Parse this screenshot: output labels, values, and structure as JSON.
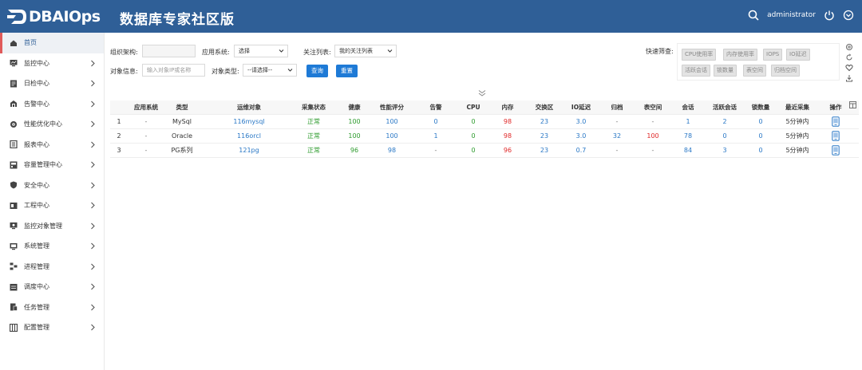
{
  "header": {
    "logo_text": "DBAIOps",
    "title": "数据库专家社区版",
    "username": "administrator"
  },
  "sidebar": {
    "items": [
      {
        "label": "首页",
        "icon": "home-icon",
        "active": true,
        "has_arrow": false
      },
      {
        "label": "监控中心",
        "icon": "monitor-icon",
        "has_arrow": true
      },
      {
        "label": "日检中心",
        "icon": "daily-check-icon",
        "has_arrow": true
      },
      {
        "label": "告警中心",
        "icon": "alarm-icon",
        "has_arrow": true
      },
      {
        "label": "性能优化中心",
        "icon": "performance-icon",
        "has_arrow": true
      },
      {
        "label": "报表中心",
        "icon": "report-icon",
        "has_arrow": true
      },
      {
        "label": "容量管理中心",
        "icon": "capacity-icon",
        "has_arrow": true
      },
      {
        "label": "安全中心",
        "icon": "shield-icon",
        "has_arrow": true
      },
      {
        "label": "工程中心",
        "icon": "project-icon",
        "has_arrow": true
      },
      {
        "label": "监控对象管理",
        "icon": "monitor-object-icon",
        "has_arrow": true
      },
      {
        "label": "系统管理",
        "icon": "system-icon",
        "has_arrow": true
      },
      {
        "label": "进程管理",
        "icon": "process-icon",
        "has_arrow": true
      },
      {
        "label": "调度中心",
        "icon": "schedule-icon",
        "has_arrow": true
      },
      {
        "label": "任务管理",
        "icon": "task-icon",
        "has_arrow": true
      },
      {
        "label": "配置管理",
        "icon": "config-icon",
        "has_arrow": true
      }
    ]
  },
  "filters": {
    "org_label": "组织架构:",
    "org_value": "",
    "app_system_label": "应用系统:",
    "app_system_value": "选择",
    "focus_list_label": "关注列表:",
    "focus_list_value": "我的关注列表",
    "object_info_label": "对象信息:",
    "object_info_placeholder": "输入对象IP或名称",
    "object_type_label": "对象类型:",
    "object_type_value": "--请选择--",
    "query_button": "查询",
    "reset_button": "重置"
  },
  "quick_filter": {
    "label": "快速筛查:",
    "tags": [
      "CPU使用率",
      "内存使用率",
      "IOPS",
      "IO延迟",
      "活跃会话",
      "锁数量",
      "表空间",
      "归档空间"
    ]
  },
  "table": {
    "headers": [
      "",
      "应用系统",
      "类型",
      "运维对象",
      "采集状态",
      "健康",
      "性能评分",
      "告警",
      "CPU",
      "内存",
      "交换区",
      "IO延迟",
      "归档",
      "表空间",
      "会话",
      "活跃会话",
      "锁数量",
      "最近采集",
      "操作"
    ],
    "rows": [
      {
        "no": "1",
        "app": "-",
        "type": "MySql",
        "obj": "116mysql",
        "state": "正常",
        "health": "100",
        "perf": "100",
        "alarm": "0",
        "cpu": "0",
        "mem": "98",
        "swap": "23",
        "io": "3.0",
        "arch": "-",
        "tbs": "-",
        "sess": "1",
        "asess": "2",
        "lock": "0",
        "last": "5分钟内"
      },
      {
        "no": "2",
        "app": "-",
        "type": "Oracle",
        "obj": "116orcl",
        "state": "正常",
        "health": "100",
        "perf": "100",
        "alarm": "1",
        "cpu": "0",
        "mem": "98",
        "swap": "23",
        "io": "3.0",
        "arch": "32",
        "tbs": "100",
        "sess": "78",
        "asess": "0",
        "lock": "0",
        "last": "5分钟内"
      },
      {
        "no": "3",
        "app": "-",
        "type": "PG系列",
        "obj": "121pg",
        "state": "正常",
        "health": "96",
        "perf": "98",
        "alarm": "-",
        "cpu": "0",
        "mem": "96",
        "swap": "23",
        "io": "0.7",
        "arch": "-",
        "tbs": "-",
        "sess": "84",
        "asess": "3",
        "lock": "0",
        "last": "5分钟内"
      }
    ]
  },
  "colors": {
    "header_bg": "#2f5f97",
    "primary_button": "#1e7ad6",
    "link_blue": "#2a78c6",
    "ok_green": "#2e9b2e",
    "warn_red": "#e02828",
    "active_marker": "#e05a5a"
  }
}
